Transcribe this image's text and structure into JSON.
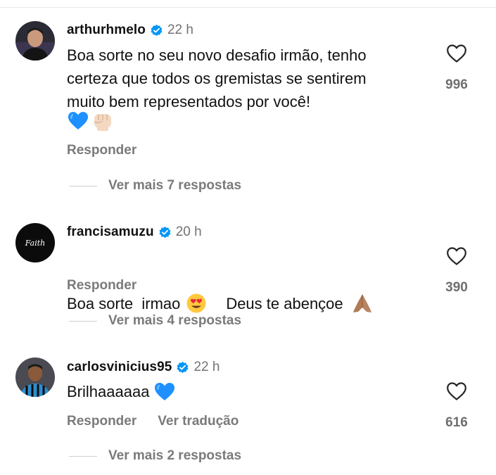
{
  "comments": [
    {
      "username": "arthurhmelo",
      "time": "22 h",
      "text_lines": [
        "Boa sorte no seu novo desafio irmão, tenho",
        "certeza que todos os gremistas se sentirem",
        "muito bem representados por você!"
      ],
      "emojis": [
        "blue-heart-icon",
        "fist-icon"
      ],
      "reply_label": "Responder",
      "likes": "996",
      "more_replies": "Ver mais 7 respostas"
    },
    {
      "username": "francisamuzu",
      "time": "20 h",
      "avatar_text": "Faith",
      "text_before": "Boa sorte  irmao",
      "text_middle": "Deus te abençoe",
      "reply_label": "Responder",
      "likes": "390",
      "more_replies": "Ver mais 4 respostas"
    },
    {
      "username": "carlosvinicius95",
      "time": "22 h",
      "text": "Brilhaaaaaa",
      "reply_label": "Responder",
      "translate_label": "Ver tradução",
      "likes": "616",
      "more_replies": "Ver mais 2 respostas"
    }
  ],
  "colors": {
    "verified_blue": "#0095f6",
    "secondary_text": "#737373",
    "primary_text": "#111111"
  }
}
